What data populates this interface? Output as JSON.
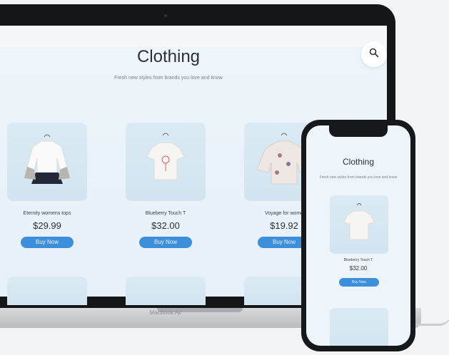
{
  "laptop": {
    "brand": "MacBook Air",
    "page": {
      "title": "Clothing",
      "subtitle": "Fresh new styles from brands you love and know",
      "search_icon": "search-icon",
      "products": [
        {
          "name": "Eternity womens tops",
          "price": "$29.99",
          "button": "Buy Now",
          "image": "white-ruffle-top"
        },
        {
          "name": "Blueberry Touch T",
          "price": "$32.00",
          "button": "Buy Now",
          "image": "white-tshirt"
        },
        {
          "name": "Voyage for wome",
          "price": "$19.92",
          "button": "Buy Now",
          "image": "floral-blouse"
        }
      ]
    }
  },
  "phone": {
    "title": "Clothing",
    "subtitle": "Fresh new styles from brands you love and know",
    "product": {
      "name": "Blueberry Touch T",
      "price": "$32.00",
      "button": "Buy Now"
    }
  },
  "colors": {
    "accent": "#3d8fdc",
    "background": "#eef5fa",
    "device": "#151618"
  }
}
